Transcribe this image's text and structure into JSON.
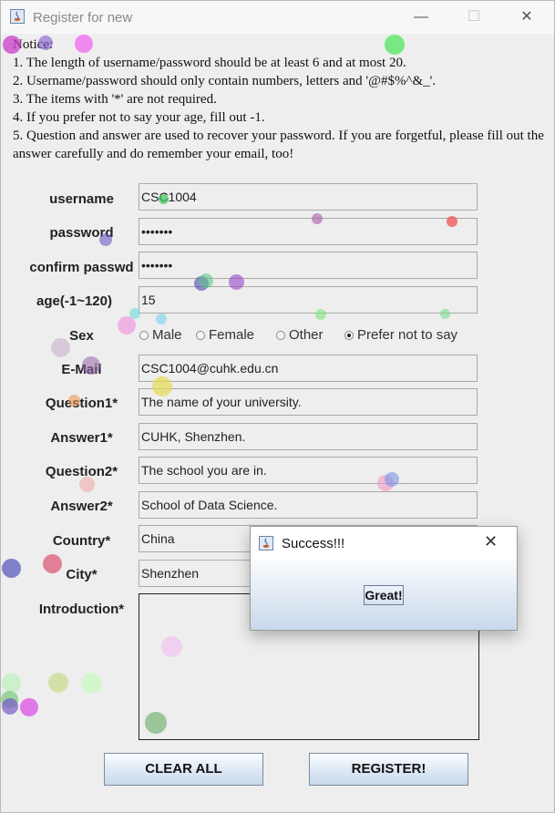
{
  "window": {
    "title": "Register for new",
    "minimize_glyph": "—",
    "maximize_glyph": "☐",
    "close_glyph": "✕"
  },
  "notice": {
    "heading": "Notice:",
    "lines": [
      "1. The length of username/password should be at least 6 and at most 20.",
      "2. Username/password should only contain numbers, letters and '@#$%^&_'.",
      "3. The items with '*' are not required.",
      "4. If you prefer not to say your age, fill out -1.",
      "5. Question and answer are used to recover your password. If you are forgetful, please fill out the answer carefully and do remember your email, too!"
    ]
  },
  "form": {
    "username": {
      "label": "username",
      "value": "CSC1004"
    },
    "password": {
      "label": "password",
      "value": "•••••••"
    },
    "confirm": {
      "label": "confirm passwd",
      "value": "•••••••"
    },
    "age": {
      "label": "age(-1~120)",
      "value": "15"
    },
    "sex": {
      "label": "Sex",
      "options": [
        "Male",
        "Female",
        "Other",
        "Prefer not to say"
      ],
      "selected": "Prefer not to say"
    },
    "email": {
      "label": "E-Mail",
      "value": "CSC1004@cuhk.edu.cn"
    },
    "question1": {
      "label": "Question1*",
      "value": "The name of your university."
    },
    "answer1": {
      "label": "Answer1*",
      "value": "CUHK, Shenzhen."
    },
    "question2": {
      "label": "Question2*",
      "value": "The school you are in."
    },
    "answer2": {
      "label": "Answer2*",
      "value": "School of Data Science."
    },
    "country": {
      "label": "Country*",
      "value": "China"
    },
    "city": {
      "label": "City*",
      "value": "Shenzhen"
    },
    "introduction": {
      "label": "Introduction*",
      "value": ""
    }
  },
  "buttons": {
    "clear": "CLEAR ALL",
    "register": "REGISTER!"
  },
  "dialog": {
    "title": "Success!!!",
    "close_glyph": "✕",
    "button": "Great!"
  }
}
